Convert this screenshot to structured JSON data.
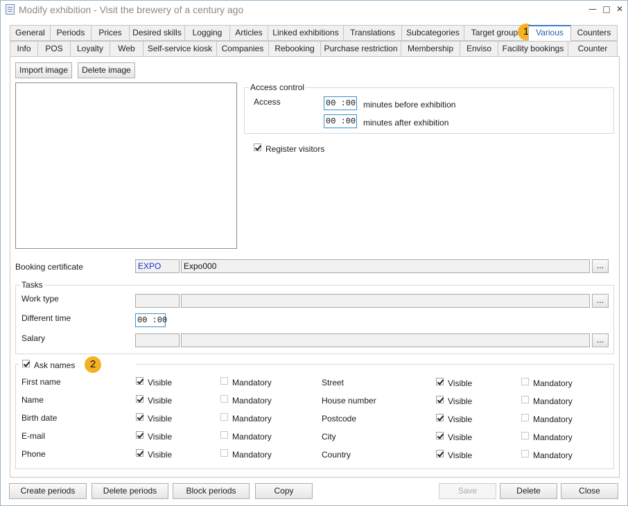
{
  "window": {
    "title": "Modify exhibition - Visit the brewery of a century ago"
  },
  "tabs_row1": [
    "General",
    "Periods",
    "Prices",
    "Desired skills",
    "Logging",
    "Articles",
    "Linked exhibitions",
    "Translations",
    "Subcategories",
    "Target groups",
    "Various",
    "Counters"
  ],
  "tabs_row2": [
    "Info",
    "POS",
    "Loyalty",
    "Web",
    "Self-service kiosk",
    "Companies",
    "Rebooking",
    "Purchase restriction",
    "Membership",
    "Enviso",
    "Facility bookings",
    "Counter"
  ],
  "active_tab": "Various",
  "image_buttons": {
    "import": "Import image",
    "delete": "Delete image"
  },
  "access_control": {
    "title": "Access control",
    "label": "Access",
    "before_value": "00 :00",
    "before_label": "minutes before exhibition",
    "after_value": "00 :00",
    "after_label": "minutes after exhibition"
  },
  "register_visitors": {
    "label": "Register visitors",
    "checked": true
  },
  "booking_certificate": {
    "label": "Booking certificate",
    "code": "EXPO",
    "name": "Expo000",
    "browse": "..."
  },
  "tasks": {
    "title": "Tasks",
    "work_type": "Work type",
    "different_time": "Different time",
    "different_time_value": "00 :00",
    "salary": "Salary",
    "browse": "..."
  },
  "ask_names": {
    "label": "Ask names",
    "checked": true,
    "visible_label": "Visible",
    "mandatory_label": "Mandatory",
    "left_fields": [
      "First name",
      "Name",
      "Birth date",
      "E-mail",
      "Phone"
    ],
    "right_fields": [
      "Street",
      "House number",
      "Postcode",
      "City",
      "Country"
    ]
  },
  "badges": [
    "1",
    "2"
  ],
  "footer": {
    "create_periods": "Create periods",
    "delete_periods": "Delete periods",
    "block_periods": "Block periods",
    "copy": "Copy",
    "save": "Save",
    "delete": "Delete",
    "close": "Close"
  },
  "colors": {
    "accent": "#3a7bc8",
    "badge": "#f3b224",
    "code_text": "#1c2fcc"
  }
}
